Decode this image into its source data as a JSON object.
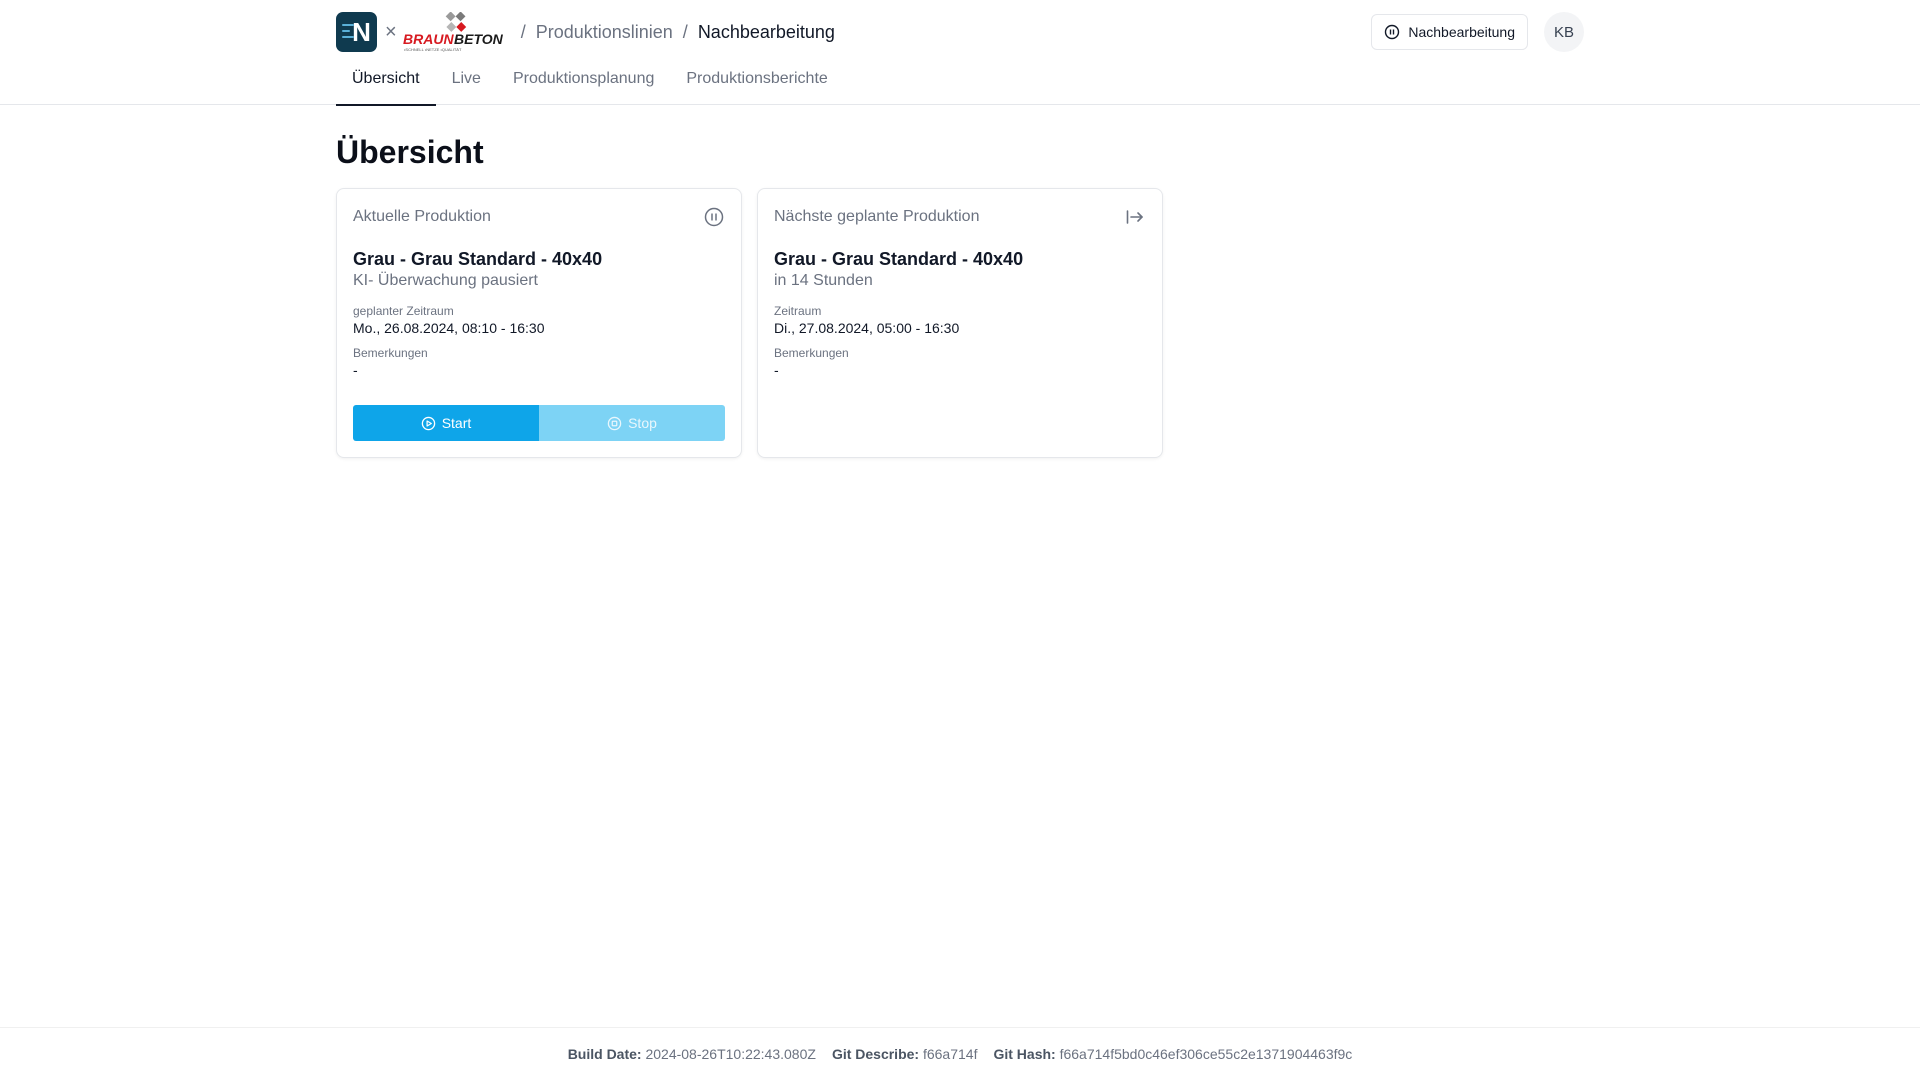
{
  "header": {
    "brand": {
      "n_logo_letter": "N",
      "separator": "×",
      "partner_logo_text": "BRAUNBETON",
      "partner_tagline": "•SCHNELL •NETZE •QUALITÄT"
    },
    "breadcrumb": {
      "separator": "/",
      "items": [
        "Produktionslinien",
        "Nachbearbeitung"
      ]
    },
    "status_button": {
      "label": "Nachbearbeitung",
      "icon": "pause-circle-icon"
    },
    "avatar_initials": "KB"
  },
  "tabs": [
    {
      "label": "Übersicht",
      "active": true
    },
    {
      "label": "Live",
      "active": false
    },
    {
      "label": "Produktionsplanung",
      "active": false
    },
    {
      "label": "Produktionsberichte",
      "active": false
    }
  ],
  "page_title": "Übersicht",
  "current_production": {
    "label": "Aktuelle Produktion",
    "icon": "pause-circle-icon",
    "product": "Grau - Grau Standard - 40x40",
    "status": "KI- Überwachung pausiert",
    "period_label": "geplanter Zeitraum",
    "period_value": "Mo., 26.08.2024, 08:10 - 16:30",
    "remarks_label": "Bemerkungen",
    "remarks_value": "-",
    "start_label": "Start",
    "stop_label": "Stop"
  },
  "next_production": {
    "label": "Nächste geplante Produktion",
    "icon": "arrow-right-to-line-icon",
    "product": "Grau - Grau Standard - 40x40",
    "eta": "in 14 Stunden",
    "period_label": "Zeitraum",
    "period_value": "Di., 27.08.2024, 05:00 - 16:30",
    "remarks_label": "Bemerkungen",
    "remarks_value": "-"
  },
  "footer": {
    "build_date_label": "Build Date:",
    "build_date": "2024-08-26T10:22:43.080Z",
    "git_describe_label": "Git Describe:",
    "git_describe": "f66a714f",
    "git_hash_label": "Git Hash:",
    "git_hash": "f66a714f5bd0c46ef306ce55c2e1371904463f9c"
  },
  "colors": {
    "accent": "#0ea5e9",
    "accent_disabled": "#7dd3f5",
    "logo_bg": "#0f3a4f",
    "brand_red": "#d71920"
  }
}
